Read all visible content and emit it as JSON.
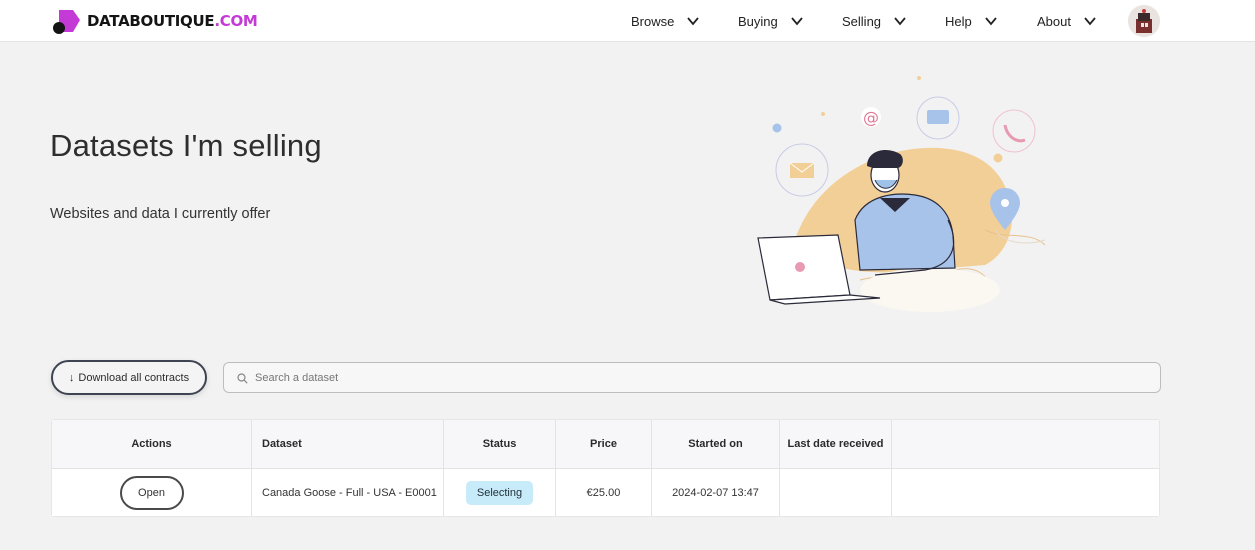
{
  "brand": {
    "data": "DATA",
    "boutique": "BOUTIQUE",
    "com": ".COM",
    "accent": "#c43ad6"
  },
  "nav": [
    {
      "label": "Browse"
    },
    {
      "label": "Buying"
    },
    {
      "label": "Selling"
    },
    {
      "label": "Help"
    },
    {
      "label": "About"
    }
  ],
  "hero": {
    "title": "Datasets I'm selling",
    "subtitle": "Websites and data I currently offer"
  },
  "toolbar": {
    "download_label": "Download all contracts",
    "download_icon": "arrow-down-icon",
    "search_placeholder": "Search a dataset",
    "search_icon": "search-icon"
  },
  "table": {
    "columns": [
      "Actions",
      "Dataset",
      "Status",
      "Price",
      "Started on",
      "Last date received",
      ""
    ],
    "rows": [
      {
        "action": "Open",
        "dataset": "Canada Goose - Full - USA - E0001",
        "status": "Selecting",
        "price": "€25.00",
        "started_on": "2024-02-07 13:47",
        "last_date_received": ""
      }
    ]
  },
  "colors": {
    "status_badge_bg": "#c8ebf9",
    "page_bg": "#f2f2f2"
  }
}
